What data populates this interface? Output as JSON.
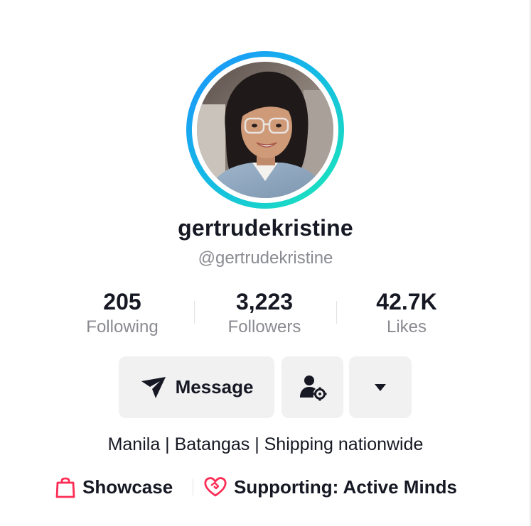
{
  "profile": {
    "display_name": "gertrudekristine",
    "handle": "@gertrudekristine",
    "avatar_icon": "profile-photo"
  },
  "stats": [
    {
      "value": "205",
      "label": "Following"
    },
    {
      "value": "3,223",
      "label": "Followers"
    },
    {
      "value": "42.7K",
      "label": "Likes"
    }
  ],
  "actions": {
    "message_label": "Message",
    "message_icon": "send-icon",
    "friend_icon": "user-settings-icon",
    "more_icon": "caret-down-icon"
  },
  "bio": "Manila | Batangas | Shipping nationwide",
  "links": {
    "showcase_label": "Showcase",
    "showcase_icon": "shopping-bag-icon",
    "support_label": "Supporting: Active Minds",
    "support_icon": "heart-handshake-icon"
  },
  "colors": {
    "ring_start": "#1e90ff",
    "ring_end": "#1de9b6",
    "accent_pink": "#fe2c55",
    "button_bg": "#f1f1f2",
    "secondary_text": "#8a8b91"
  }
}
